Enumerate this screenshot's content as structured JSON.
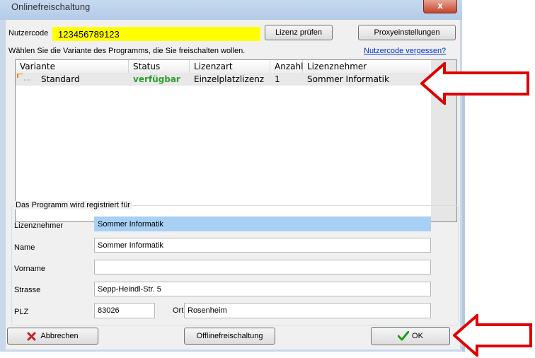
{
  "window": {
    "title": "Onlinefreischaltung",
    "close_symbol": "x"
  },
  "top": {
    "nutzercode_label": "Nutzercode",
    "nutzercode_value": "123456789123",
    "lizenz_pruefen": "Lizenz prüfen",
    "proxy": "Proxyeinstellungen",
    "instruction": "Wählen Sie die Variante des Programms, die Sie freischalten wollen.",
    "forgot_link": "Nutzercode vergessen?"
  },
  "table": {
    "columns": [
      "Variante",
      "Status",
      "Lizenzart",
      "Anzahl",
      "Lizenznehmer"
    ],
    "rows": [
      {
        "variante": "Standard",
        "status": "verfügbar",
        "lizenzart": "Einzelplatzlizenz",
        "anzahl": "1",
        "lizenznehmer": "Sommer Informatik"
      }
    ],
    "status_color": "#2e9e2e"
  },
  "registration": {
    "group_label": "Das Programm wird registriert für",
    "fields": {
      "lizenznehmer": {
        "label": "Lizenznehmer",
        "value": "Sommer Informatik"
      },
      "name": {
        "label": "Name",
        "value": "Sommer Informatik"
      },
      "vorname": {
        "label": "Vorname",
        "value": ""
      },
      "strasse": {
        "label": "Strasse",
        "value": "Sepp-Heindl-Str. 5"
      },
      "plz": {
        "label": "PLZ",
        "value": "83026"
      },
      "ort": {
        "label": "Ort",
        "value": "Rosenheim"
      }
    }
  },
  "buttons": {
    "abbrechen": "Abbrechen",
    "offline": "Offlinefreischaltung",
    "ok": "OK"
  },
  "colors": {
    "highlight_yellow": "#ffff00",
    "selection_blue": "#a8d0f5",
    "arrow_red": "#e00000",
    "link_blue": "#0033cc"
  }
}
